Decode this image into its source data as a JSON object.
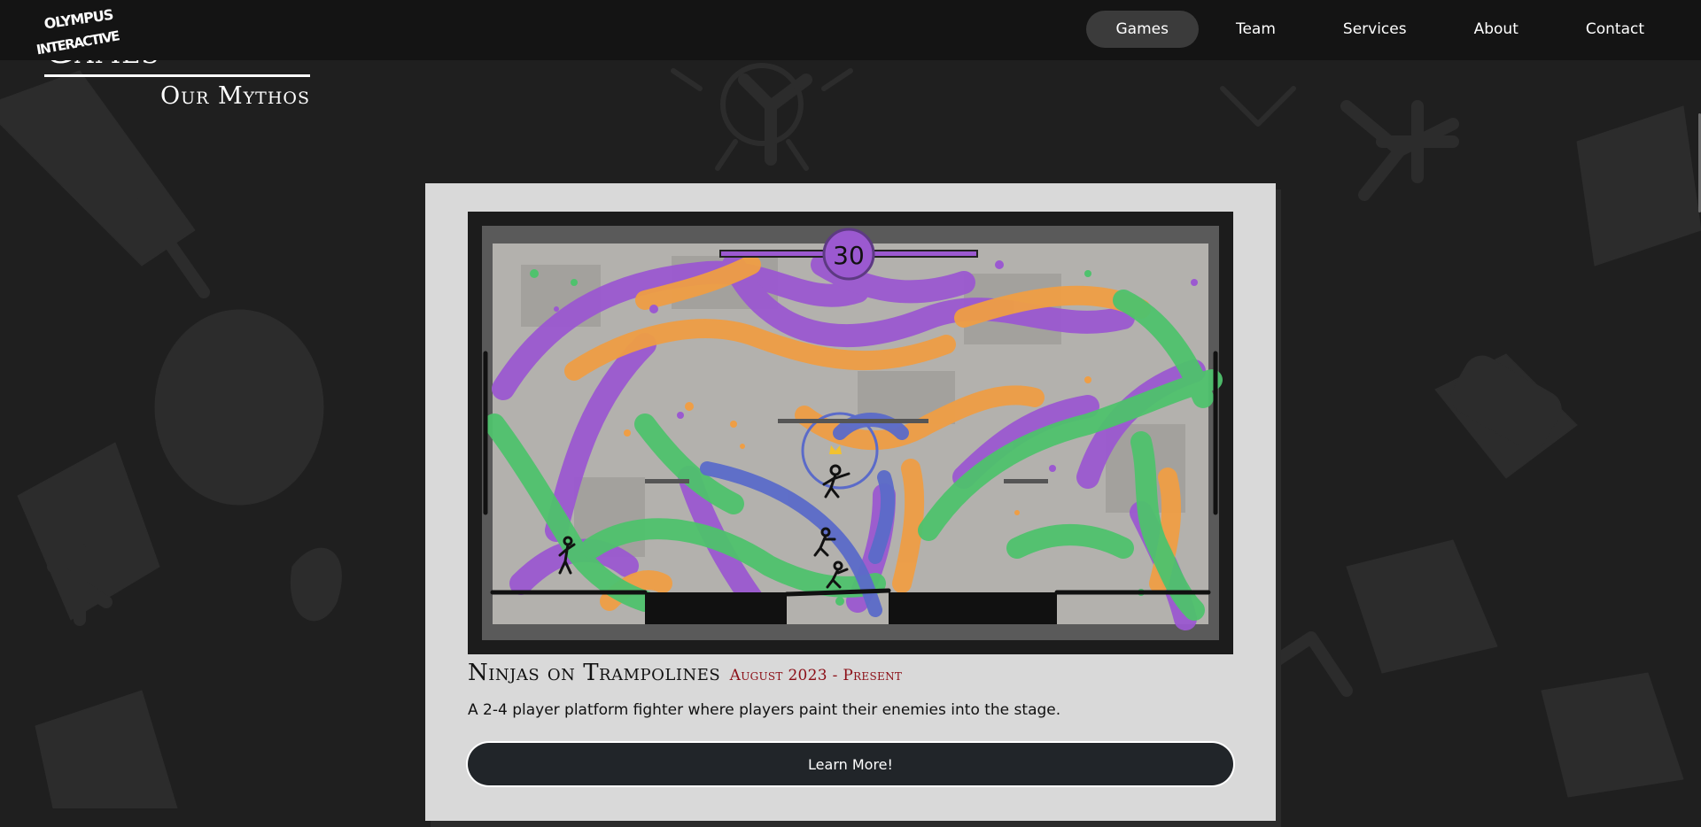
{
  "logo": {
    "name": "Olympus Interactive",
    "line1": "OLYMPUS",
    "line2": "INTERACTIVE"
  },
  "nav": {
    "items": [
      {
        "label": "Games",
        "active": true
      },
      {
        "label": "Team",
        "active": false
      },
      {
        "label": "Services",
        "active": false
      },
      {
        "label": "About",
        "active": false
      },
      {
        "label": "Contact",
        "active": false
      }
    ]
  },
  "section": {
    "title": "Games",
    "subtitle": "Our Mythos"
  },
  "game": {
    "timer": "30",
    "title": "Ninjas on Trampolines",
    "date": "August 2023 - Present",
    "description": "A 2-4 player platform fighter where players paint their enemies into the stage.",
    "button_label": "Learn More!"
  },
  "colors": {
    "background": "#1f1f1f",
    "navbar": "#141414",
    "card": "#d9d9d9",
    "date_accent": "#8b0e16",
    "button": "#212529",
    "paint_purple": "#9b59d0",
    "paint_orange": "#ef9e45",
    "paint_green": "#4fc26d",
    "paint_blue": "#5b6bc9"
  }
}
